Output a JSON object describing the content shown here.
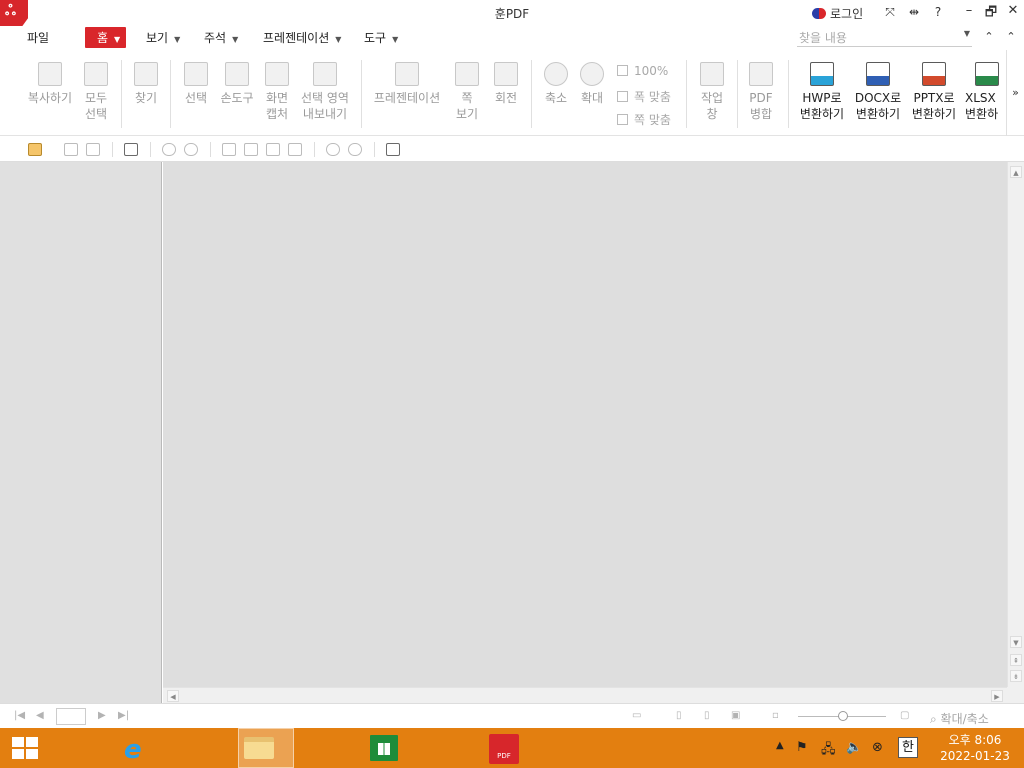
{
  "window": {
    "title": "훈PDF",
    "logo_glyph": "ஃ",
    "login_label": "로그인",
    "controls": {
      "minimize": "–",
      "restore": "🗗",
      "close": "✕"
    },
    "extra_icons": [
      "⤧",
      "⇹",
      "?"
    ]
  },
  "menubar": {
    "file": "파일",
    "items": [
      {
        "label": "홈",
        "active": true
      },
      {
        "label": "보기"
      },
      {
        "label": "주석"
      },
      {
        "label": "프레젠테이션"
      },
      {
        "label": "도구"
      }
    ],
    "search_placeholder": "찾을 내용",
    "nav": [
      "⌃",
      "⌃",
      "✕"
    ]
  },
  "ribbon": {
    "copy": {
      "line1": "복사하기"
    },
    "select_all": {
      "line1": "모두",
      "line2": "선택"
    },
    "find": {
      "line1": "찾기"
    },
    "select": {
      "line1": "선택"
    },
    "hand_tool": {
      "line1": "손도구"
    },
    "screen_capture": {
      "line1": "화면",
      "line2": "캡처"
    },
    "export_area": {
      "line1": "선택 영역",
      "line2": "내보내기"
    },
    "presentation": {
      "line1": "프레젠테이션"
    },
    "page_view": {
      "line1": "쪽",
      "line2": "보기"
    },
    "rotate": {
      "line1": "회전"
    },
    "zoom_out": {
      "line1": "축소"
    },
    "zoom_in": {
      "line1": "확대"
    },
    "zoom_level": "100%",
    "fit_width": "폭 맞춤",
    "fit_page": "쪽 맞춤",
    "work_window": {
      "line1": "작업",
      "line2": "창"
    },
    "pdf_merge": {
      "line1": "PDF",
      "line2": "병합"
    },
    "to_hwp": {
      "line1": "HWP로",
      "line2": "변환하기"
    },
    "to_docx": {
      "line1": "DOCX로",
      "line2": "변환하기"
    },
    "to_pptx": {
      "line1": "PPTX로",
      "line2": "변환하기"
    },
    "to_xlsx": {
      "line1": "XLSX",
      "line2": "변환하"
    },
    "more": "»"
  },
  "statusbar": {
    "zoom_label": "확대/축소"
  },
  "taskbar": {
    "ime": "한",
    "clock_time": "오후 8:06",
    "clock_date": "2022-01-23",
    "pdf_app_label": "PDF"
  },
  "colors": {
    "accent": "#d9262b",
    "taskbar": "#e37f10"
  }
}
